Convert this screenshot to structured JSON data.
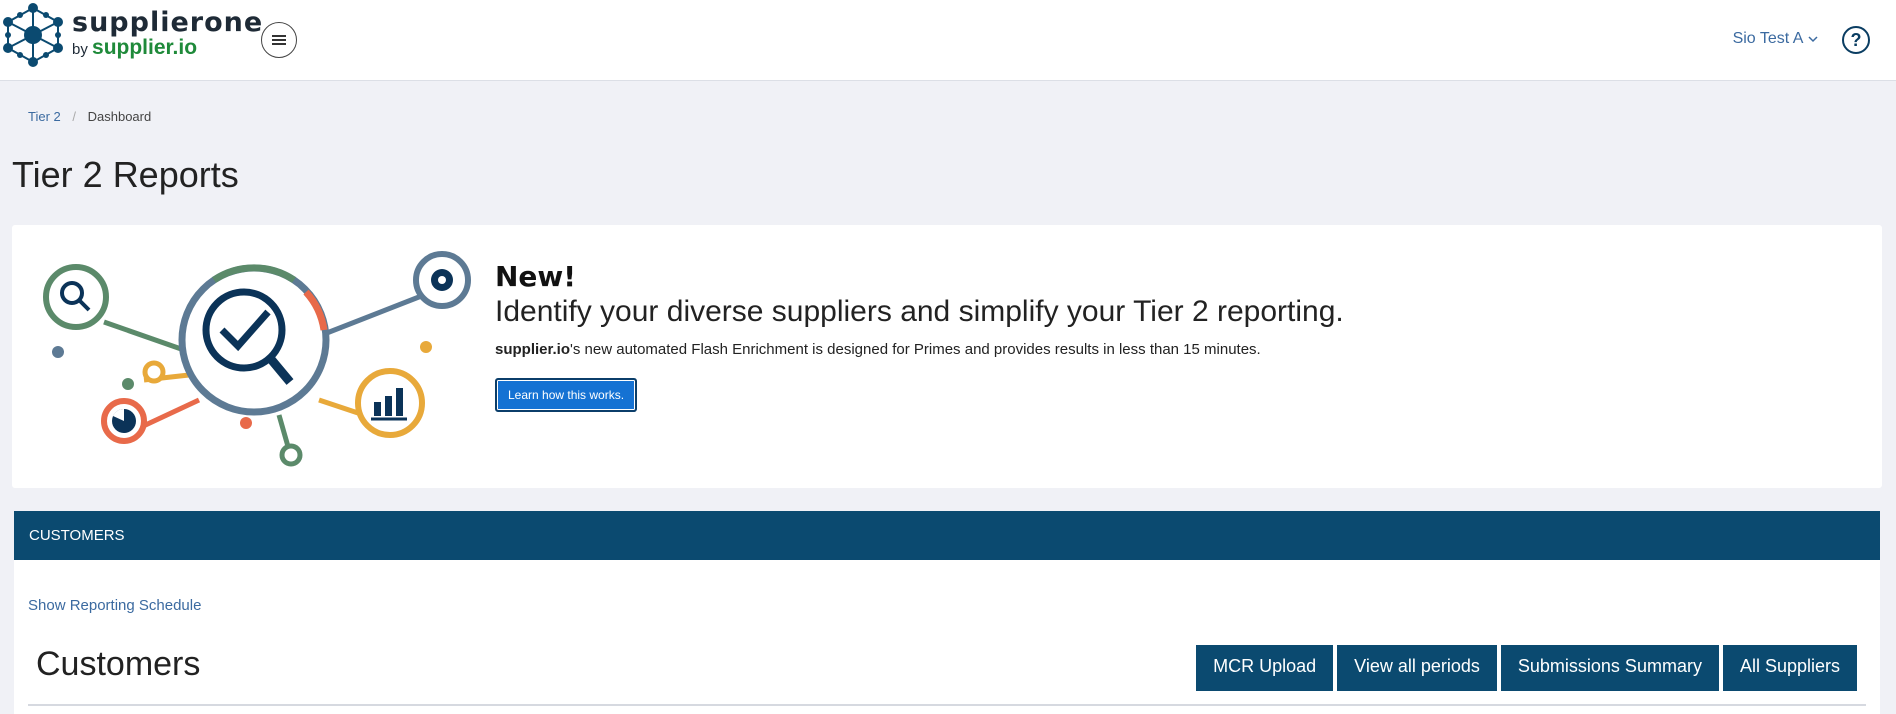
{
  "header": {
    "brand_name": "supplierone",
    "brand_by": "by",
    "brand_sub": "supplier.io",
    "user_menu": "Sio Test A",
    "help": "?"
  },
  "breadcrumb": {
    "parent": "Tier 2",
    "current": "Dashboard"
  },
  "page_title": "Tier 2 Reports",
  "promo": {
    "new_label": "New!",
    "headline": "Identify your diverse suppliers and simplify your Tier 2 reporting.",
    "desc_brand": "supplier.io",
    "desc_rest": "'s new automated Flash Enrichment is designed for Primes and provides results in less than 15 minutes.",
    "button": "Learn how this works."
  },
  "customers": {
    "section_label": "CUSTOMERS",
    "schedule_link": "Show Reporting Schedule",
    "title": "Customers",
    "actions": [
      "MCR Upload",
      "View all periods",
      "Submissions Summary",
      "All Suppliers"
    ]
  },
  "colors": {
    "navy": "#0b4a70",
    "link": "#3b6aa0",
    "button_blue": "#1572d3",
    "green": "#1f8a3a"
  }
}
